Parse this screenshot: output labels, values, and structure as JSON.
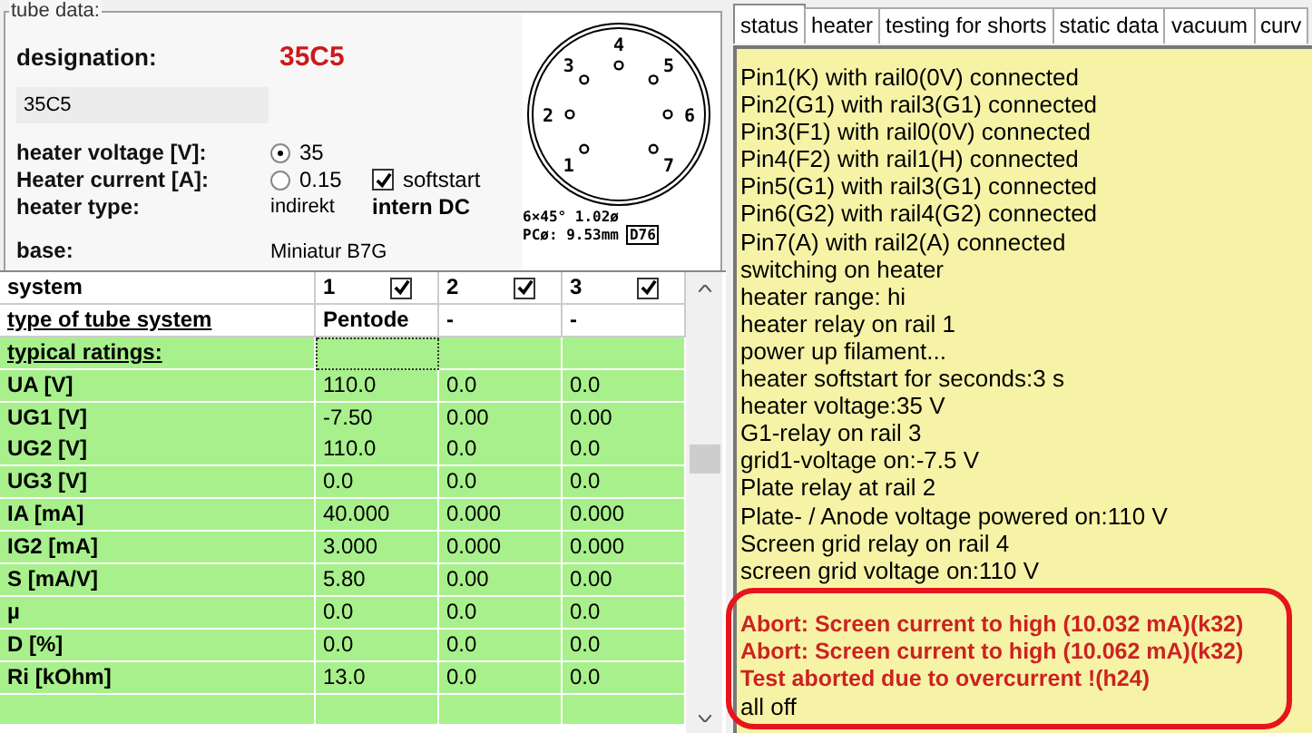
{
  "tube_data": {
    "legend": "tube data:",
    "designation_label": "designation:",
    "designation": "35C5",
    "name_value": "35C5",
    "heater_voltage_label": "heater voltage [V]:",
    "heater_current_label": "Heater current [A]:",
    "heater_type_label": "heater type:",
    "heater_options": [
      {
        "label": "35",
        "selected": true
      },
      {
        "label": "0.15",
        "selected": false
      }
    ],
    "softstart": {
      "label": "softstart",
      "checked": true
    },
    "heater_type": "indirekt",
    "heater_supply": "intern DC",
    "base_label": "base:",
    "base": "Miniatur B7G"
  },
  "pinout": {
    "pins": [
      "1",
      "2",
      "3",
      "4",
      "5",
      "6",
      "7"
    ],
    "caption_1": "6×45°  1.02ø",
    "caption_2": "PCø: 9.53mm",
    "base_code": "D76"
  },
  "table": {
    "header": {
      "label": "system",
      "systems": [
        {
          "label": "1",
          "checked": true
        },
        {
          "label": "2",
          "checked": true
        },
        {
          "label": "3",
          "checked": true
        }
      ]
    },
    "rows": [
      {
        "kind": "heading",
        "label": "type of tube system",
        "cells": [
          "Pentode",
          "-",
          "-"
        ]
      },
      {
        "kind": "section",
        "label": "typical ratings:",
        "cells": []
      },
      {
        "kind": "value",
        "label": "UA [V]",
        "cells": [
          "110.0",
          "0.0",
          "0.0"
        ]
      },
      {
        "kind": "value",
        "label": "UG1 [V]",
        "cells": [
          "-7.50",
          "0.00",
          "0.00"
        ]
      },
      {
        "kind": "value",
        "label": "UG2 [V]",
        "cells": [
          "110.0",
          "0.0",
          "0.0"
        ]
      },
      {
        "kind": "value",
        "label": "UG3 [V]",
        "cells": [
          "0.0",
          "0.0",
          "0.0"
        ]
      },
      {
        "kind": "value",
        "label": "IA [mA]",
        "cells": [
          "40.000",
          "0.000",
          "0.000"
        ]
      },
      {
        "kind": "value",
        "label": "IG2 [mA]",
        "cells": [
          "3.000",
          "0.000",
          "0.000"
        ]
      },
      {
        "kind": "value",
        "label": "S [mA/V]",
        "cells": [
          "5.80",
          "0.00",
          "0.00"
        ]
      },
      {
        "kind": "value",
        "label": "µ",
        "cells": [
          "0.0",
          "0.0",
          "0.0"
        ]
      },
      {
        "kind": "value",
        "label": "D [%]",
        "cells": [
          "0.0",
          "0.0",
          "0.0"
        ]
      },
      {
        "kind": "value",
        "label": "Ri [kOhm]",
        "cells": [
          "13.0",
          "0.0",
          "0.0"
        ]
      },
      {
        "kind": "empty",
        "label": "",
        "cells": []
      }
    ]
  },
  "tabs": [
    {
      "label": "status",
      "selected": true
    },
    {
      "label": "heater",
      "selected": false
    },
    {
      "label": "testing for shorts",
      "selected": false
    },
    {
      "label": "static data",
      "selected": false
    },
    {
      "label": "vacuum",
      "selected": false
    },
    {
      "label": "curv",
      "selected": false
    }
  ],
  "log": [
    {
      "kind": "info",
      "text": "Pin1(K) with rail0(0V) connected"
    },
    {
      "kind": "info",
      "text": "Pin2(G1) with rail3(G1) connected"
    },
    {
      "kind": "info",
      "text": "Pin3(F1) with rail0(0V) connected"
    },
    {
      "kind": "info",
      "text": "Pin4(F2) with rail1(H) connected"
    },
    {
      "kind": "info",
      "text": "Pin5(G1) with rail3(G1) connected"
    },
    {
      "kind": "info",
      "text": "Pin6(G2) with rail4(G2) connected"
    },
    {
      "kind": "info",
      "text": "Pin7(A) with rail2(A) connected"
    },
    {
      "kind": "info",
      "text": "switching on heater"
    },
    {
      "kind": "info",
      "text": "heater range: hi"
    },
    {
      "kind": "info",
      "text": "heater relay on rail 1"
    },
    {
      "kind": "info",
      "text": "power up filament..."
    },
    {
      "kind": "info",
      "text": "heater softstart for seconds:3 s"
    },
    {
      "kind": "info",
      "text": "heater voltage:35 V"
    },
    {
      "kind": "info",
      "text": "G1-relay on rail 3"
    },
    {
      "kind": "info",
      "text": "grid1-voltage on:-7.5 V"
    },
    {
      "kind": "info",
      "text": "Plate relay at rail 2"
    },
    {
      "kind": "info",
      "text": "Plate- / Anode voltage powered on:110 V"
    },
    {
      "kind": "info",
      "text": "Screen grid relay on rail 4"
    },
    {
      "kind": "info",
      "text": "screen grid voltage on:110 V"
    },
    {
      "kind": "spacer"
    },
    {
      "kind": "error",
      "text": "Abort: Screen current to high (10.032 mA)(k32)"
    },
    {
      "kind": "error",
      "text": "Abort: Screen current to high (10.062 mA)(k32)"
    },
    {
      "kind": "error",
      "text": "Test aborted due to overcurrent  !(h24)"
    },
    {
      "kind": "info",
      "text": "all off"
    }
  ]
}
